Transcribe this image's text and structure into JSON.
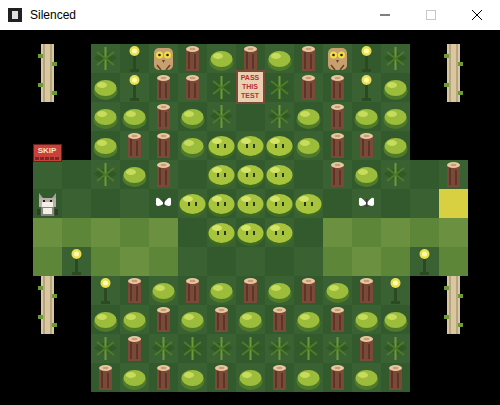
{
  "window": {
    "title": "Silenced"
  },
  "board": {
    "rows": [
      "X#VPOLBLBLOPV#X",
      "X#BPLLVTVLLPB#X",
      "##BBLBV.VBLBB##",
      "##BLLBSSSBLLB##",
      "K.VBL.SSS.LBV.L",
      "C...WSSSSS.W..Y",
      "ggggg.SSS.ggggg",
      "gPggg.....gggPg",
      "X#PLBLBLBLBLP#X",
      "X#BBLBLBLBLBB#X",
      "##VLVVVVVVVLV##",
      "##LBLBLBLBLBL##"
    ]
  },
  "signs": {
    "test": {
      "lines": [
        "PASS",
        "THIS",
        "TEST"
      ]
    },
    "skip": {
      "label": "SKIP",
      "level": 0
    }
  }
}
